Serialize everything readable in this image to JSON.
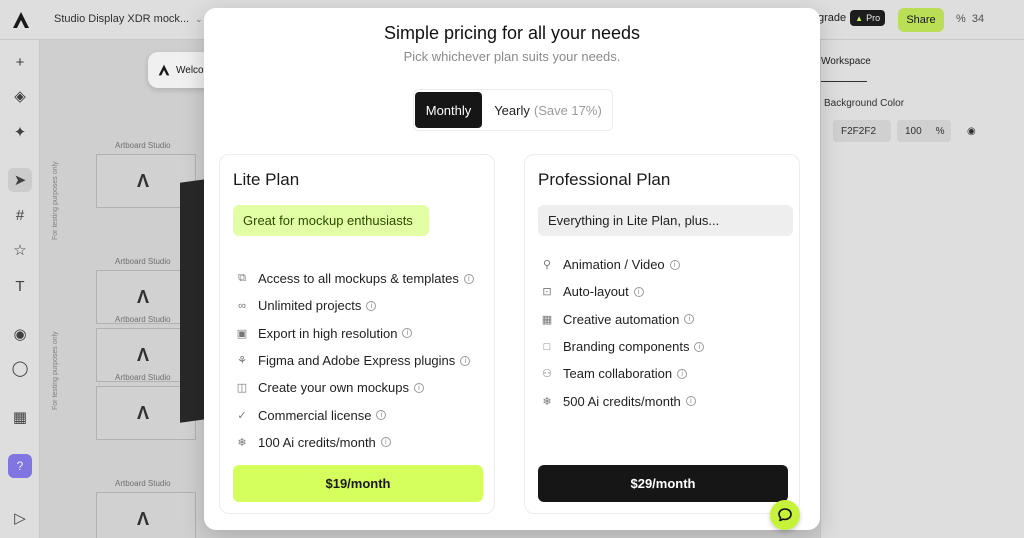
{
  "app": {
    "doc_title": "Studio Display XDR mock...",
    "upgrade_label": "grade",
    "pro_badge": "Pro",
    "share_label": "Share",
    "zoom_symbol": "%",
    "zoom_value": "34",
    "welcome_text": "Welco",
    "accent_color": "#c6ec5c"
  },
  "toolbar": {
    "tools": [
      "plus-icon",
      "layers-icon",
      "sparkle-icon",
      "pointer-icon",
      "frame-icon",
      "star-icon",
      "text-icon",
      "pen-icon",
      "drop-icon",
      "table-icon",
      "help-icon",
      "play-icon"
    ]
  },
  "canvas": {
    "artboard_label": "Artboard Studio",
    "vertical_label": "For testing purposes only"
  },
  "right_panel": {
    "tab": "Workspace",
    "background_label": "Background Color",
    "hex_value": "F2F2F2",
    "opacity_value": "100",
    "opacity_unit": "%"
  },
  "modal": {
    "title": "Simple pricing for all your needs",
    "subtitle": "Pick whichever plan suits your needs.",
    "billing_toggle": {
      "monthly": "Monthly",
      "yearly": "Yearly",
      "yearly_note": "(Save 17%)",
      "selected": "Monthly"
    },
    "plans": [
      {
        "name": "Lite Plan",
        "tagline": "Great for mockup enthusiasts",
        "features": [
          {
            "icon": "mockup-icon",
            "label": "Access to all mockups & templates"
          },
          {
            "icon": "infinity-icon",
            "label": "Unlimited projects"
          },
          {
            "icon": "image-icon",
            "label": "Export in high resolution"
          },
          {
            "icon": "plugin-icon",
            "label": "Figma and Adobe Express plugins"
          },
          {
            "icon": "create-mockup-icon",
            "label": "Create your own mockups"
          },
          {
            "icon": "check-icon",
            "label": "Commercial license"
          },
          {
            "icon": "snowflake-icon",
            "label": "100 Ai credits/month"
          }
        ],
        "cta": "$19/month"
      },
      {
        "name": "Professional Plan",
        "tagline": "Everything in Lite Plan, plus...",
        "features": [
          {
            "icon": "animation-icon",
            "label": "Animation / Video"
          },
          {
            "icon": "auto-layout-icon",
            "label": "Auto-layout"
          },
          {
            "icon": "grid-icon",
            "label": "Creative automation"
          },
          {
            "icon": "folder-icon",
            "label": "Branding components"
          },
          {
            "icon": "team-icon",
            "label": "Team collaboration"
          },
          {
            "icon": "snowflake-icon",
            "label": "500 Ai credits/month"
          }
        ],
        "cta": "$29/month"
      }
    ]
  }
}
